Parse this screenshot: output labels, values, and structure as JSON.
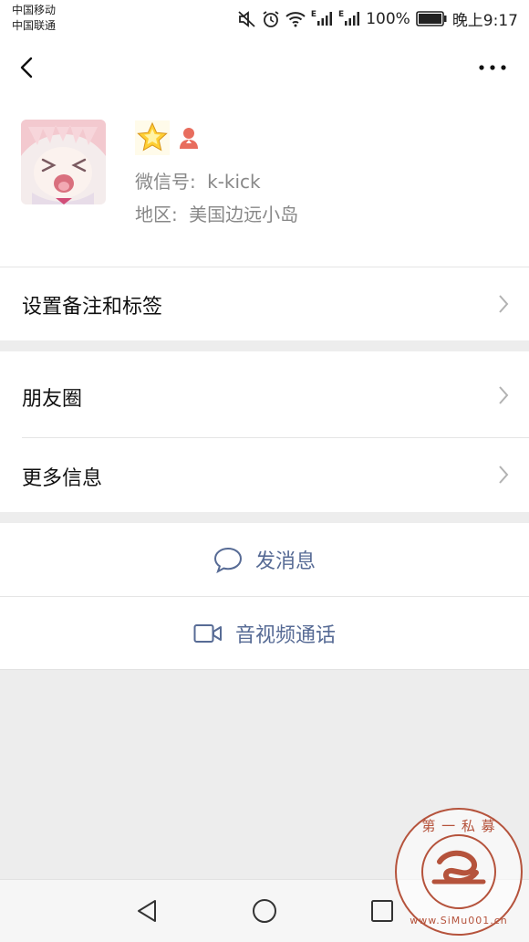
{
  "status_bar": {
    "carrier_1": "中国移动",
    "carrier_2": "中国联通",
    "signal_1_label": "E",
    "signal_2_label": "E",
    "battery_text": "100%",
    "time": "晚上9:17"
  },
  "header": {
    "back_icon": "chevron-left-icon",
    "more_icon": "more-dots-icon"
  },
  "profile": {
    "wechat_id_label": "微信号:",
    "wechat_id": "k-kick",
    "region_label": "地区:",
    "region": "美国边远小岛"
  },
  "menu": {
    "remark_tags": "设置备注和标签",
    "moments": "朋友圈",
    "more_info": "更多信息"
  },
  "actions": {
    "send_message": "发消息",
    "video_call": "音视频通话"
  },
  "watermark": {
    "top_text": "第 一 私 募",
    "url_text": "www.SiMu001.cn"
  },
  "colors": {
    "link": "#576b95",
    "background": "#ededed",
    "watermark": "#b5533c"
  }
}
